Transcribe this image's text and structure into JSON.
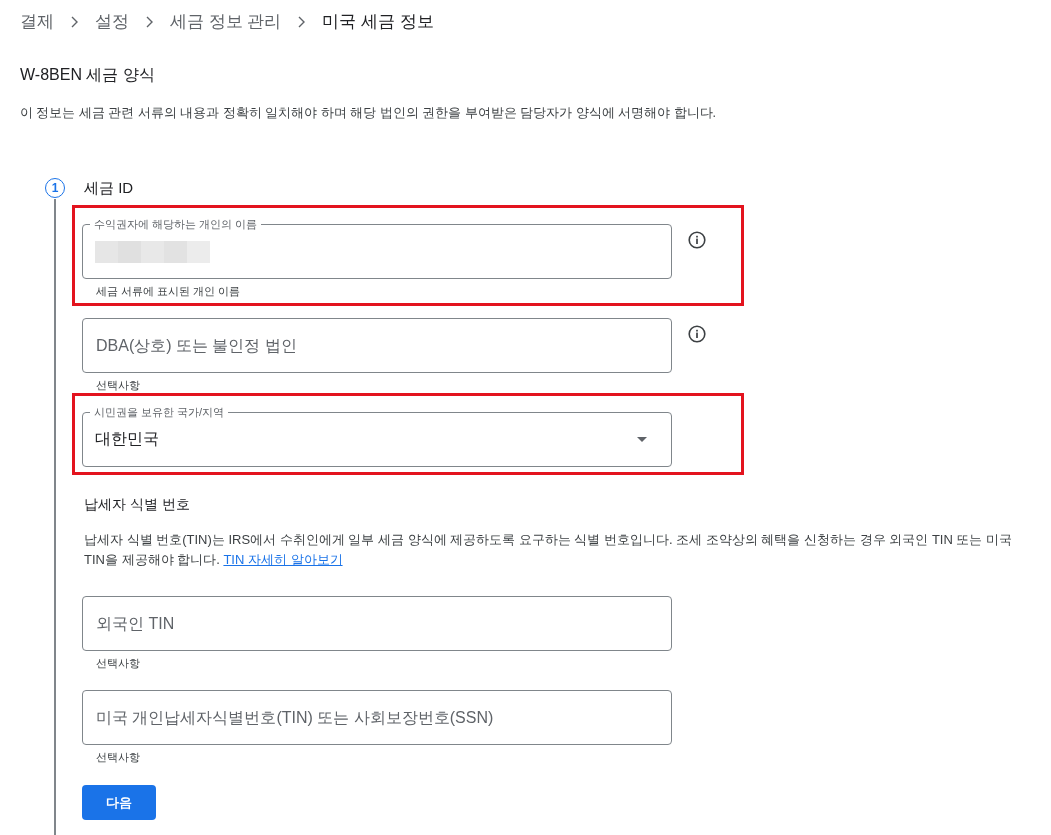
{
  "breadcrumb": [
    {
      "label": "결제",
      "current": false
    },
    {
      "label": "설정",
      "current": false
    },
    {
      "label": "세금 정보 관리",
      "current": false
    },
    {
      "label": "미국 세금 정보",
      "current": true
    }
  ],
  "form_title": "W-8BEN 세금 양식",
  "description": "이 정보는 세금 관련 서류의 내용과 정확히 일치해야 하며 해당 법인의 권한을 부여받은 담당자가 양식에 서명해야 합니다.",
  "step": {
    "number": "1",
    "title": "세금 ID",
    "fields": [
      {
        "kind": "text",
        "label": "수익권자에 해당하는 개인의 이름",
        "redacted": true,
        "helper": "세금 서류에 표시된 개인 이름",
        "info": true,
        "highlighted": true
      },
      {
        "kind": "text",
        "placeholder": "DBA(상호) 또는 불인정 법인",
        "helper": "선택사항",
        "info": true,
        "highlighted": false
      },
      {
        "kind": "select",
        "label": "시민권을 보유한 국가/지역",
        "value": "대한민국",
        "info": false,
        "highlighted": true
      }
    ],
    "tin_section": {
      "title": "납세자 식별 번호",
      "text": "납세자 식별 번호(TIN)는 IRS에서 수취인에게 일부 세금 양식에 제공하도록 요구하는 식별 번호입니다. 조세 조약상의 혜택을 신청하는 경우 외국인 TIN 또는 미국 TIN을 제공해야 합니다.",
      "link": "TIN 자세히 알아보기",
      "fields": [
        {
          "kind": "text",
          "placeholder": "외국인 TIN",
          "helper": "선택사항",
          "info": false,
          "highlighted": false
        },
        {
          "kind": "text",
          "placeholder": "미국 개인납세자식별번호(TIN) 또는 사회보장번호(SSN)",
          "helper": "선택사항",
          "info": false,
          "highlighted": false
        }
      ]
    },
    "next_button": "다음"
  }
}
